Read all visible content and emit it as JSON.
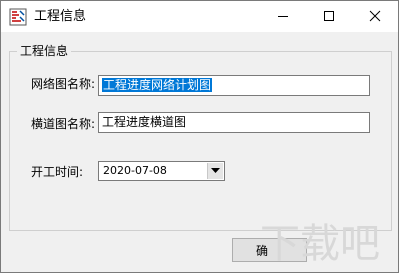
{
  "window": {
    "title": "工程信息",
    "icon": "app-icon",
    "controls": [
      "minimize-icon",
      "maximize-icon",
      "close-icon"
    ]
  },
  "group": {
    "title": "工程信息"
  },
  "fields": {
    "network_name": {
      "label": "网络图名称:",
      "value": "工程进度网络计划图",
      "state": "selected"
    },
    "bar_name": {
      "label": "横道图名称:",
      "value": "工程进度横道图"
    },
    "start_time": {
      "label": "开工时间:",
      "value": "2020-07-08"
    }
  },
  "buttons": {
    "ok_label": "确"
  },
  "watermark": {
    "text": "下载吧"
  },
  "colors": {
    "selection": "#0078d7",
    "window_bg": "#f0f0f0",
    "titlebar_bg": "#ffffff"
  }
}
